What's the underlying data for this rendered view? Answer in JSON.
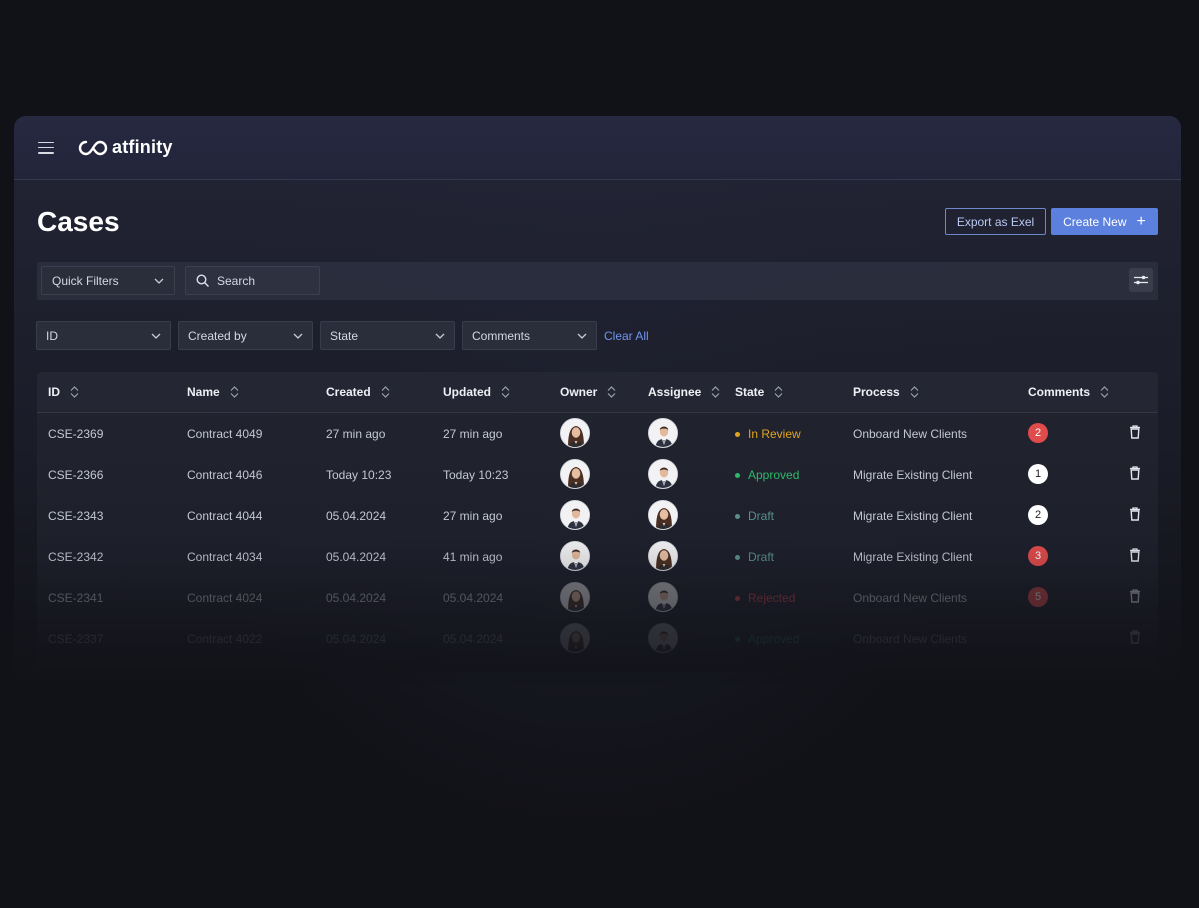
{
  "header": {
    "logo_text": "atfinity"
  },
  "page": {
    "title": "Cases",
    "export_label": "Export as Exel",
    "create_label": "Create New"
  },
  "filters": {
    "quick_filters_label": "Quick Filters",
    "search_placeholder": "Search",
    "dropdowns": [
      "ID",
      "Created by",
      "State",
      "Comments"
    ],
    "clear_all_label": "Clear All"
  },
  "table": {
    "columns": [
      "ID",
      "Name",
      "Created",
      "Updated",
      "Owner",
      "Assignee",
      "State",
      "Process",
      "Comments"
    ],
    "rows": [
      {
        "id": "CSE-2369",
        "name": "Contract 4049",
        "created": "27 min ago",
        "updated": "27 min ago",
        "owner": "woman",
        "assignee": "man",
        "state": "In Review",
        "state_color": "#e0a422",
        "process": "Onboard New Clients",
        "comments": "2",
        "comments_style": "red"
      },
      {
        "id": "CSE-2366",
        "name": "Contract 4046",
        "created": "Today 10:23",
        "updated": "Today 10:23",
        "owner": "woman",
        "assignee": "man",
        "state": "Approved",
        "state_color": "#2fb86a",
        "process": "Migrate Existing Client",
        "comments": "1",
        "comments_style": "white"
      },
      {
        "id": "CSE-2343",
        "name": "Contract 4044",
        "created": "05.04.2024",
        "updated": "27 min ago",
        "owner": "man",
        "assignee": "woman",
        "state": "Draft",
        "state_color": "#5a8f8d",
        "process": "Migrate Existing Client",
        "comments": "2",
        "comments_style": "white"
      },
      {
        "id": "CSE-2342",
        "name": "Contract 4034",
        "created": "05.04.2024",
        "updated": "41 min ago",
        "owner": "man",
        "assignee": "woman",
        "state": "Draft",
        "state_color": "#5a8f8d",
        "process": "Migrate Existing Client",
        "comments": "3",
        "comments_style": "red"
      },
      {
        "id": "CSE-2341",
        "name": "Contract 4024",
        "created": "05.04.2024",
        "updated": "05.04.2024",
        "owner": "woman",
        "assignee": "man",
        "state": "Rejected",
        "state_color": "#d6444a",
        "process": "Onboard New Clients",
        "comments": "5",
        "comments_style": "red"
      },
      {
        "id": "CSE-2337",
        "name": "Contract 4022",
        "created": "05.04.2024",
        "updated": "05.04.2024",
        "owner": "woman",
        "assignee": "man",
        "state": "Approved",
        "state_color": "#2fb86a",
        "process": "Onboard New Clients",
        "comments": "",
        "comments_style": "none"
      }
    ]
  },
  "colors": {
    "accent": "#5b80dd",
    "link": "#6f95ec",
    "badge_red": "#e04b4b"
  }
}
